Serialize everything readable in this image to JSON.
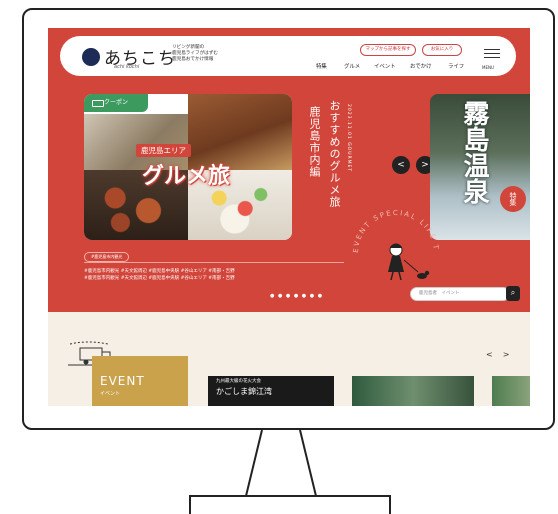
{
  "site": {
    "logo_text": "あちこち",
    "logo_sub": "achi kochi",
    "tagline": [
      "リビング新聞の",
      "鹿児島ライフがはずむ",
      "鹿児島おでかけ情報"
    ]
  },
  "header": {
    "map_button": "マップから記事を探す",
    "fav_button": "お気に入り",
    "nav": [
      "特集",
      "グルメ",
      "イベント",
      "おでかけ",
      "ライフ"
    ],
    "menu_label": "MENU"
  },
  "feature": {
    "coupon_label": "クーポン",
    "area_tag": "鹿児島エリア",
    "title": "グルメ旅",
    "vertical_title": "おすすめのグルメ旅",
    "vertical_area": "鹿児島市内編",
    "vertical_small": "2023.11.01  GOURMET",
    "highlight_tag": "#鹿児島市内観光",
    "hashtags_row1": "#鹿児島市内観光   #天文館周辺   #鹿児島中央駅   #谷山エリア   #南部・吉野",
    "hashtags_row2": "#鹿児島市内観光   #天文館周辺   #鹿児島中央駅   #谷山エリア   #南部・吉野",
    "slide_dots": "● ● ● ● ● ● ●"
  },
  "onsen": {
    "title": "霧島温泉",
    "badge": "特集"
  },
  "circle_text": "EVENT SPECIAL LIFE TRIP",
  "search": {
    "placeholder": "鹿児島者　イベント"
  },
  "carousel": {
    "prev": "<",
    "next": ">"
  },
  "lower": {
    "event_label": "EVENT",
    "event_sub": "イベント",
    "news1_line1": "九州最大級の花火大会",
    "news1_line2": "かごしま錦江湾",
    "lower_prev": "<",
    "lower_next": ">"
  }
}
